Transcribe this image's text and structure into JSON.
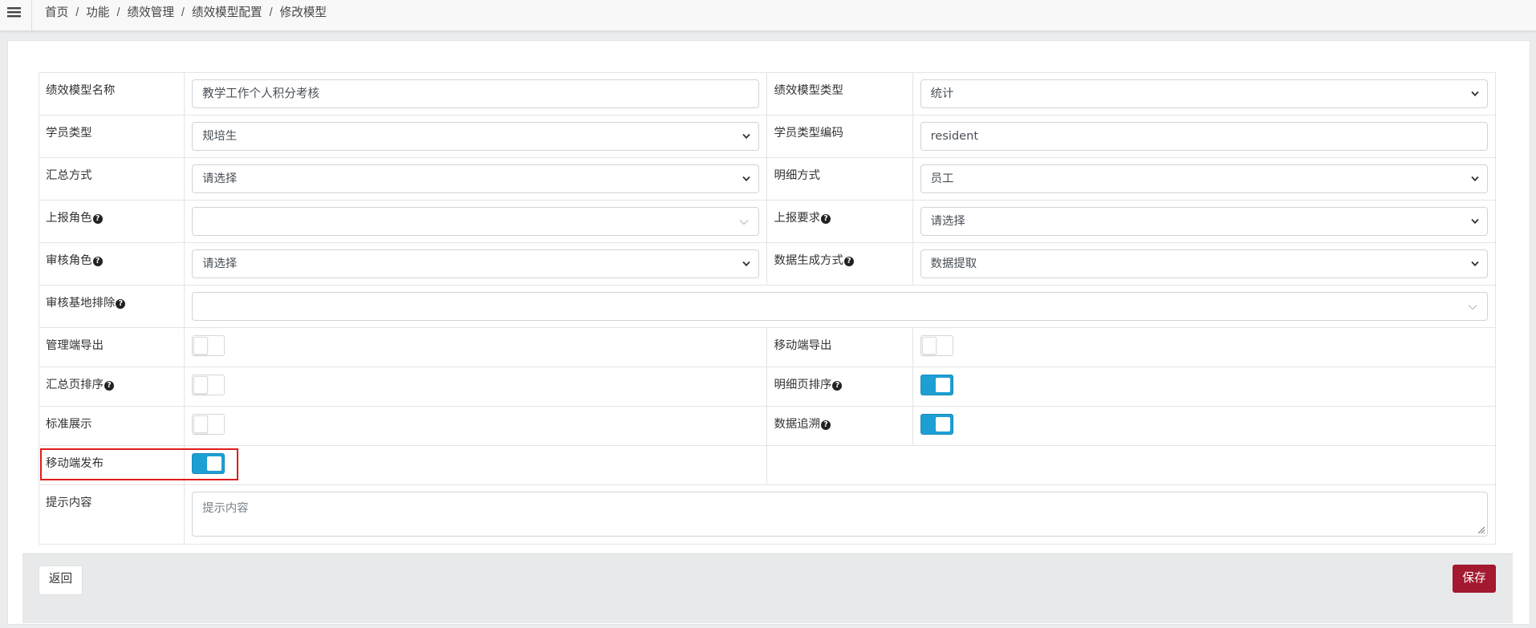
{
  "topbar": {
    "menu_icon": "hamburger-menu-icon",
    "breadcrumb": [
      "首页",
      "功能",
      "绩效管理",
      "绩效模型配置",
      "修改模型"
    ],
    "separator": "/"
  },
  "form": {
    "model_name": {
      "label": "绩效模型名称",
      "value": "教学工作个人积分考核"
    },
    "model_type": {
      "label": "绩效模型类型",
      "value": "统计"
    },
    "student_type": {
      "label": "学员类型",
      "value": "规培生"
    },
    "student_type_code": {
      "label": "学员类型编码",
      "value": "resident"
    },
    "summary_method": {
      "label": "汇总方式",
      "value": "请选择"
    },
    "detail_method": {
      "label": "明细方式",
      "value": "员工"
    },
    "report_role": {
      "label": "上报角色",
      "value": ""
    },
    "report_requirement": {
      "label": "上报要求",
      "value": "请选择"
    },
    "review_role": {
      "label": "审核角色",
      "value": "请选择"
    },
    "data_generation": {
      "label": "数据生成方式",
      "value": "数据提取"
    },
    "review_base_exclusion": {
      "label": "审核基地排除",
      "value": ""
    },
    "admin_export": {
      "label": "管理端导出",
      "on": false
    },
    "mobile_export": {
      "label": "移动端导出",
      "on": false
    },
    "summary_sort": {
      "label": "汇总页排序",
      "on": false
    },
    "detail_sort": {
      "label": "明细页排序",
      "on": true
    },
    "standard_display": {
      "label": "标准展示",
      "on": false
    },
    "data_trace": {
      "label": "数据追溯",
      "on": true
    },
    "mobile_publish": {
      "label": "移动端发布",
      "on": true
    },
    "hint_content": {
      "label": "提示内容",
      "placeholder": "提示内容"
    }
  },
  "help_glyph": "?",
  "footer": {
    "back_label": "返回",
    "save_label": "保存"
  },
  "colors": {
    "toggle_on": "#1e9fd3",
    "save_button": "#a3192f",
    "highlight": "#e01c1c"
  }
}
